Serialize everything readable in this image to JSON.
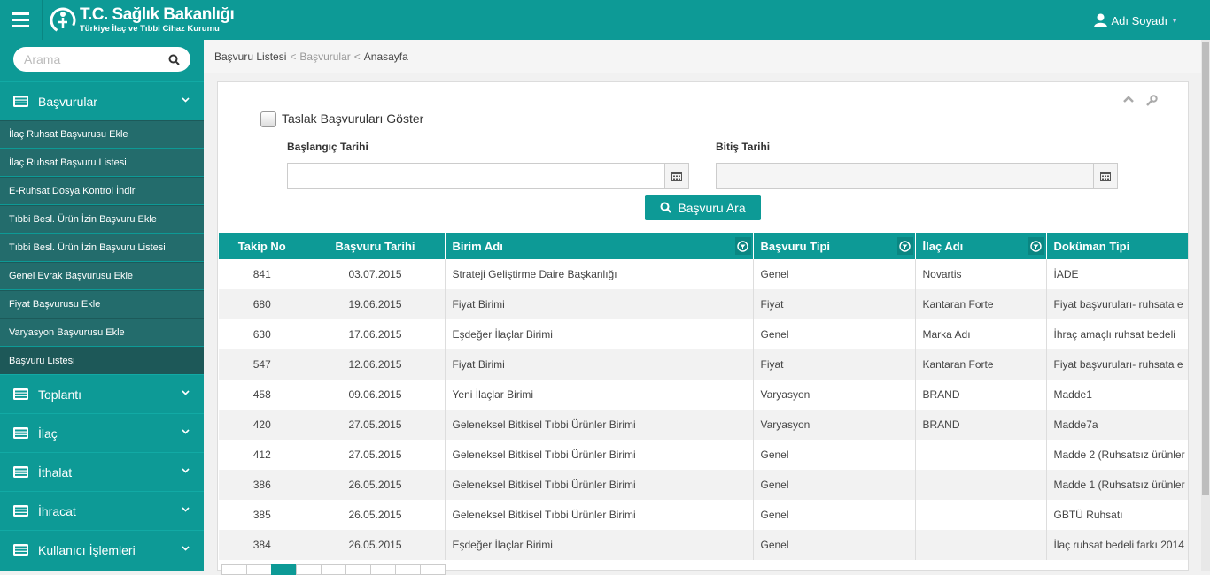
{
  "app": {
    "brand_title": "T.C. Sağlık Bakanlığı",
    "brand_subtitle": "Türkiye İlaç ve Tıbbi Cihaz Kurumu",
    "user_name": "Adı Soyadı",
    "accent_color": "#0d9a96"
  },
  "sidebar": {
    "search_placeholder": "Arama",
    "menus": [
      {
        "label": "Başvurular",
        "icon": "list-icon",
        "expanded": true
      },
      {
        "label": "Toplantı",
        "icon": "list-icon"
      },
      {
        "label": "İlaç",
        "icon": "list-icon"
      },
      {
        "label": "İthalat",
        "icon": "list-icon"
      },
      {
        "label": "İhracat",
        "icon": "list-icon"
      },
      {
        "label": "Kullanıcı İşlemleri",
        "icon": "list-icon"
      }
    ],
    "sub_items": [
      "İlaç Ruhsat Başvurusu Ekle",
      "İlaç Ruhsat Başvuru Listesi",
      "E-Ruhsat Dosya Kontrol İndir",
      "Tıbbi Besl. Ürün İzin Başvuru Ekle",
      "Tıbbi Besl. Ürün İzin Başvuru Listesi",
      "Genel Evrak Başvurusu Ekle",
      "Fiyat Başvurusu Ekle",
      "Varyasyon Başvurusu Ekle",
      "Başvuru Listesi"
    ]
  },
  "breadcrumb": {
    "current": "Başvuru Listesi",
    "parent": "Başvurular",
    "root": "Anasayfa",
    "separator": "<"
  },
  "filters": {
    "draft_label": "Taslak Başvuruları Göster",
    "start_label": "Başlangıç Tarihi",
    "end_label": "Bitiş Tarihi",
    "start_value": "",
    "end_value": "",
    "search_button": "Başvuru Ara"
  },
  "table": {
    "headers": [
      "Takip No",
      "Başvuru Tarihi",
      "Birim Adı",
      "Başvuru Tipi",
      "İlaç Adı",
      "Doküman Tipi"
    ],
    "rows": [
      [
        "841",
        "03.07.2015",
        "Strateji Geliştirme Daire Başkanlığı",
        "Genel",
        "Novartis",
        "İADE"
      ],
      [
        "680",
        "19.06.2015",
        "Fiyat Birimi",
        "Fiyat",
        "Kantaran Forte",
        "Fiyat başvuruları- ruhsata e"
      ],
      [
        "630",
        "17.06.2015",
        "Eşdeğer İlaçlar Birimi",
        "Genel",
        "Marka Adı",
        "İhraç amaçlı ruhsat bedeli"
      ],
      [
        "547",
        "12.06.2015",
        "Fiyat Birimi",
        "Fiyat",
        "Kantaran Forte",
        "Fiyat başvuruları- ruhsata e"
      ],
      [
        "458",
        "09.06.2015",
        "Yeni İlaçlar Birimi",
        "Varyasyon",
        "BRAND",
        "Madde1"
      ],
      [
        "420",
        "27.05.2015",
        "Geleneksel Bitkisel Tıbbi Ürünler Birimi",
        "Varyasyon",
        "BRAND",
        "Madde7a"
      ],
      [
        "412",
        "27.05.2015",
        "Geleneksel Bitkisel Tıbbi Ürünler Birimi",
        "Genel",
        "",
        "Madde 2 (Ruhsatsız ürünler"
      ],
      [
        "386",
        "26.05.2015",
        "Geleneksel Bitkisel Tıbbi Ürünler Birimi",
        "Genel",
        "",
        "Madde 1 (Ruhsatsız ürünler"
      ],
      [
        "385",
        "26.05.2015",
        "Geleneksel Bitkisel Tıbbi Ürünler Birimi",
        "Genel",
        "",
        "GBTÜ Ruhsatı"
      ],
      [
        "384",
        "26.05.2015",
        "Eşdeğer İlaçlar Birimi",
        "Genel",
        "",
        "İlaç ruhsat bedeli farkı 2014"
      ]
    ]
  },
  "pager": {
    "page_count": 9,
    "active_page": 3
  }
}
